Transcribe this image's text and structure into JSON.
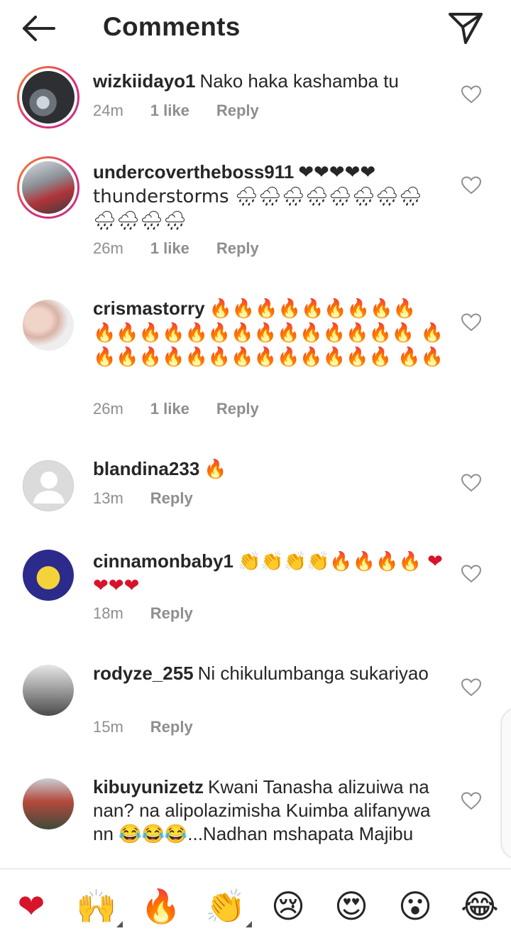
{
  "header": {
    "title": "Comments"
  },
  "comments": [
    {
      "username": "wizkiidayo1",
      "text": "Nako haka kashamba tu",
      "time": "24m",
      "likes": "1 like",
      "reply": "Reply"
    },
    {
      "username": "undercovertheboss911",
      "text": "❤❤❤❤❤ thunderstorms 🌧🌧🌧🌧🌧🌧🌧🌧 🌧🌧🌧🌧",
      "time": "26m",
      "likes": "1 like",
      "reply": "Reply"
    },
    {
      "username": "crismastorry",
      "text": "🔥🔥🔥🔥🔥🔥🔥🔥🔥 🔥🔥🔥🔥🔥🔥🔥🔥🔥🔥🔥🔥🔥🔥 🔥🔥🔥🔥🔥🔥🔥🔥🔥🔥🔥🔥🔥🔥 🔥🔥",
      "time": "26m",
      "likes": "1 like",
      "reply": "Reply"
    },
    {
      "username": "blandina233",
      "text": "🔥",
      "time": "13m",
      "reply": "Reply"
    },
    {
      "username": "cinnamonbaby1",
      "text": "👏👏👏👏🔥🔥🔥🔥 ❤❤❤❤",
      "time": "18m",
      "reply": "Reply"
    },
    {
      "username": "rodyze_255",
      "text": "Ni chikulumbanga sukariyao",
      "time": "15m",
      "reply": "Reply"
    },
    {
      "username": "kibuyunizetz",
      "text": "Kwani Tanasha alizuiwa na nan? na alipolazimisha Kuimba alifanywa nn 😂😂😂...Nadhan mshapata Majibu",
      "time": "",
      "reply": ""
    }
  ],
  "reactions": [
    "❤",
    "🙌",
    "🔥",
    "👏",
    "😢",
    "😍",
    "😮",
    "😂"
  ],
  "icons": {
    "back": "arrow-left-icon",
    "send": "paper-plane-icon",
    "like": "heart-outline-icon"
  }
}
